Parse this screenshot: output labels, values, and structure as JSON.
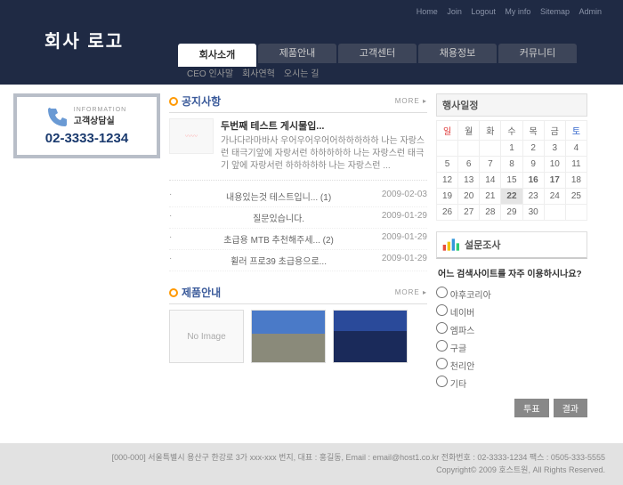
{
  "toplinks": [
    "Home",
    "Join",
    "Logout",
    "My info",
    "Sitemap",
    "Admin"
  ],
  "logo": "회사 로고",
  "nav": [
    {
      "label": "회사소개",
      "active": true
    },
    {
      "label": "제품안내",
      "active": false
    },
    {
      "label": "고객센터",
      "active": false
    },
    {
      "label": "채용정보",
      "active": false
    },
    {
      "label": "커뮤니티",
      "active": false
    }
  ],
  "subnav": [
    "CEO 인사말",
    "회사연혁",
    "오시는 길"
  ],
  "infobox": {
    "small": "INFORMATION",
    "kr": "고객상담실",
    "phone": "02-3333-1234"
  },
  "notice": {
    "title": "공지사항",
    "more": "MORE ▸",
    "feat": {
      "title": "두번째 테스트 게시물입...",
      "body": "가나다라마바사 우어우어우어어하하하하하 나는 자랑스런 태극기앞에 자랑서런 하하하하하 나는 자랑스런 태극기 앞에 자랑서런 하하하하하 나는 자랑스런 ..."
    },
    "list": [
      {
        "t": "내용있는것 테스트입니... (1)",
        "d": "2009-02-03"
      },
      {
        "t": "질문있습니다.",
        "d": "2009-01-29"
      },
      {
        "t": "초급용 MTB 추천해주세... (2)",
        "d": "2009-01-29"
      },
      {
        "t": "휠러 프로39 초급용으로...",
        "d": "2009-01-29"
      }
    ]
  },
  "products": {
    "title": "제품안내",
    "more": "MORE ▸",
    "noimage": "No Image"
  },
  "calendar": {
    "title": "행사일정",
    "days": [
      "일",
      "월",
      "화",
      "수",
      "목",
      "금",
      "토"
    ],
    "rows": [
      [
        "",
        "",
        "",
        "1",
        "2",
        "3",
        "4"
      ],
      [
        "5",
        "6",
        "7",
        "8",
        "9",
        "10",
        "11"
      ],
      [
        "12",
        "13",
        "14",
        "15",
        "16",
        "17",
        "18"
      ],
      [
        "19",
        "20",
        "21",
        "22",
        "23",
        "24",
        "25"
      ],
      [
        "26",
        "27",
        "28",
        "29",
        "30",
        "",
        ""
      ]
    ],
    "today": "22",
    "bold": [
      "16",
      "17"
    ]
  },
  "poll": {
    "title": "설문조사",
    "question": "어느 검색사이트를 자주 이용하시나요?",
    "options": [
      "야후코리아",
      "네이버",
      "엠파스",
      "구글",
      "천리안",
      "기타"
    ],
    "vote": "투표",
    "result": "결과"
  },
  "footer": {
    "line1": "[000-000] 서울특별시 용산구 한강로 3가 xxx-xxx 번지,   대표 : 홍길동, Email : email@host1.co.kr 전화번호 : 02-3333-1234  팩스 : 0505-333-5555",
    "line2": "Copyright© 2009 호스트원, All Rights Reserved."
  }
}
